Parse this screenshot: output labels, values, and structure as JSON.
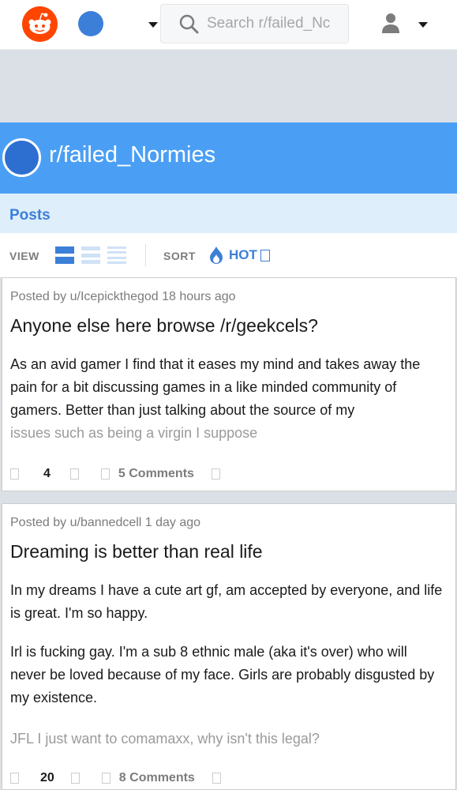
{
  "search": {
    "placeholder": "Search r/failed_Nc"
  },
  "subreddit": {
    "name": "r/failed_Normies"
  },
  "tabs": {
    "posts": "Posts"
  },
  "view": {
    "label": "VIEW"
  },
  "sort": {
    "label": "SORT",
    "value": "HOT"
  },
  "colors": {
    "accent": "#3b7fd9",
    "header": "#4a9ff5",
    "logo": "#ff4500",
    "tabbar": "#dfeefb"
  },
  "posts": [
    {
      "meta": "Posted by u/Icepickthegod 18 hours ago",
      "title": "Anyone else here browse /r/geekcels?",
      "body": "As an avid gamer I find that it eases my mind and takes away the pain for a bit discussing games in a like minded community of gamers. Better than just talking about the source of my",
      "body_fade": "issues such as being a virgin I suppose",
      "votes": "4",
      "comments": "5 Comments"
    },
    {
      "meta": "Posted by u/bannedcell 1 day ago",
      "title": "Dreaming is better than real life",
      "body1": "In my dreams I have a cute art gf, am accepted by everyone, and life is great. I'm so happy.",
      "body2": "Irl is fucking gay. I'm a sub 8 ethnic male (aka it's over) who will never be loved because of my face. Girls are probably disgusted by my existence.",
      "body_fade": "JFL I just want to comamaxx, why isn't this legal?",
      "votes": "20",
      "comments": "8 Comments"
    }
  ]
}
